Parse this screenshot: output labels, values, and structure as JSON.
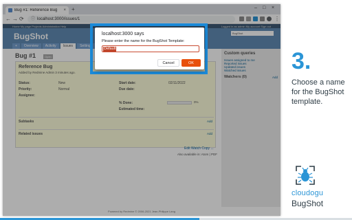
{
  "browser": {
    "tab_title": "Bug #1: Reference Bug",
    "tab_close": "×",
    "new_tab": "+",
    "win_min": "–",
    "win_max": "□",
    "win_close": "×",
    "back": "←",
    "forward": "→",
    "reload": "⟳",
    "url": "localhost:3000/issues/1",
    "lock": "ⓘ"
  },
  "redmine": {
    "top_menu_left": "Home  My page  Projects  Administration  Help",
    "top_menu_right": "Logged in as admin   My account   Sign out",
    "project_title": "BugShot",
    "search_label": "Search:",
    "project_jump": "BugShot",
    "tabs": [
      "+",
      "Overview",
      "Activity",
      "Issues",
      "Settings"
    ],
    "issue_title": "Bug #1",
    "issue_badge": "Open",
    "subject": "Reference Bug",
    "added_by": "Added by Redmine Admin 3 minutes ago.",
    "attrs_left": [
      {
        "label": "Status:",
        "value": "New"
      },
      {
        "label": "Priority:",
        "value": "Normal"
      },
      {
        "label": "Assignee:",
        "value": ""
      }
    ],
    "attrs_right": [
      {
        "label": "Start date:",
        "value": "02/11/2022"
      },
      {
        "label": "Due date:",
        "value": ""
      },
      {
        "label": "% Done:",
        "value": "0%"
      },
      {
        "label": "Estimated time:",
        "value": ""
      }
    ],
    "progress_done": 0,
    "bugshot_button": "Bugshot",
    "subtasks": "Subtasks",
    "related": "Related issues",
    "add": "Add",
    "actions": "Edit   Watch   Copy   ...",
    "formats": "Also available in: Atom | PDF",
    "sidebar_title": "Custom queries",
    "sidebar_links": [
      "Issues assigned to me",
      "Reported issues",
      "Updated issues",
      "Watched issues"
    ],
    "watchers": "Watchers (0)",
    "watchers_add": "Add",
    "footer": "Powered by Redmine © 2006-2021 Jean-Philippe Lang"
  },
  "dialog": {
    "title": "localhost:3000 says",
    "prompt": "Please enter the name for the BugShot Template:",
    "input_value": "Default",
    "cancel_label": "Cancel",
    "ok_label": "OK"
  },
  "tutorial": {
    "step_number": "3.",
    "step_text": "Choose a name for the BugShot template.",
    "brand_line1": "cloudogu",
    "brand_line2": "BugShot"
  },
  "colors": {
    "accent": "#2b95d6",
    "highlight_border": "#1b8ad8",
    "ok_button": "#e8500c",
    "redmine_header": "#628db6"
  }
}
